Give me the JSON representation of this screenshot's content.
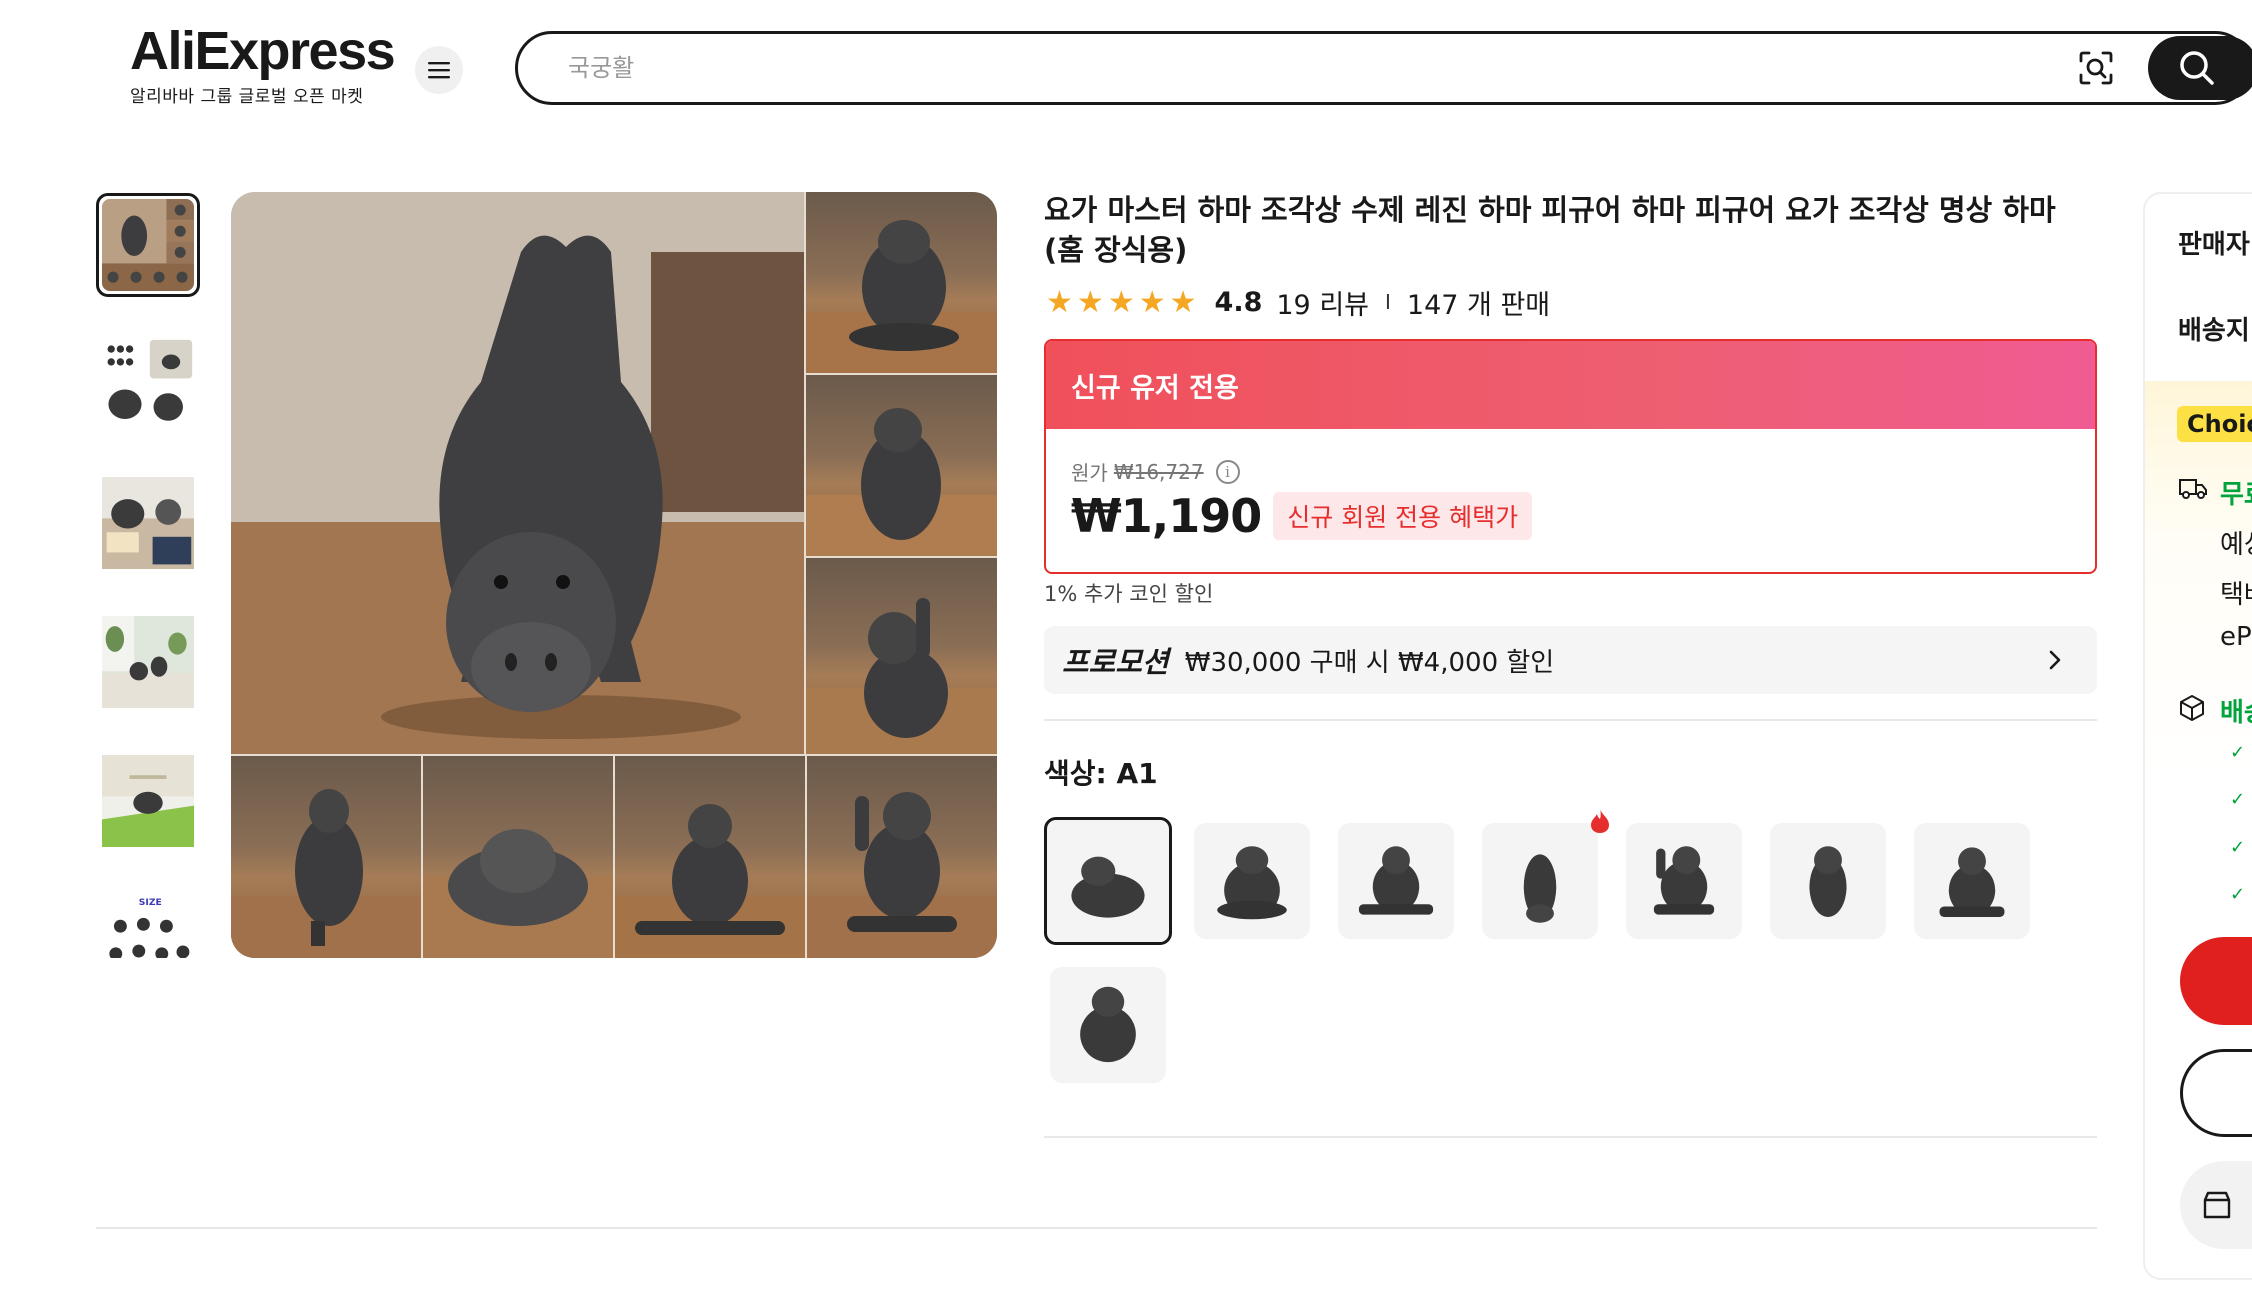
{
  "header": {
    "logo_text": "AliExpress",
    "logo_sub": "알리바바 그룹 글로벌 오픈 마켓",
    "search_placeholder": "국궁활",
    "menu_icon": "hamburger-icon",
    "scan_icon": "image-search-icon",
    "search_icon": "search-icon"
  },
  "gallery": {
    "thumb_count": 6,
    "size_label": "SIZE"
  },
  "product": {
    "title": "요가 마스터 하마 조각상 수제 레진 하마 피규어 하마 피규어 요가 조각상 명상 하마 (홈 장식용)",
    "rating": "4.8",
    "reviews": "19 리뷰",
    "separator": "I",
    "sold": "147 개 판매",
    "stars": 5
  },
  "promo_card": {
    "header": "신규 유저 전용",
    "original_label": "원가",
    "original_price": "₩16,727",
    "price": "₩1,190",
    "badge": "신규 회원 전용 혜택가"
  },
  "coin_discount": "1% 추가 코인 할인",
  "promotion": {
    "tag": "프로모션",
    "text": "₩30,000 구매 시 ₩4,000 할인"
  },
  "color": {
    "label": "색상: A1",
    "option_count": 8,
    "selected_index": 0,
    "hot_index": 3
  },
  "sidebar": {
    "seller": "판매자",
    "ship_to": "배송지",
    "choice": "Choice",
    "free_ship": "무료",
    "estimate": "예상",
    "courier": "택배",
    "ep": "eP",
    "delivery": "배송"
  },
  "colors": {
    "accent_red": "#e62e2e",
    "promo_gradient_start": "#f0505a",
    "promo_gradient_end": "#f05b93",
    "star": "#f5a623",
    "choice_yellow": "#fde043",
    "green": "#00a33c"
  }
}
